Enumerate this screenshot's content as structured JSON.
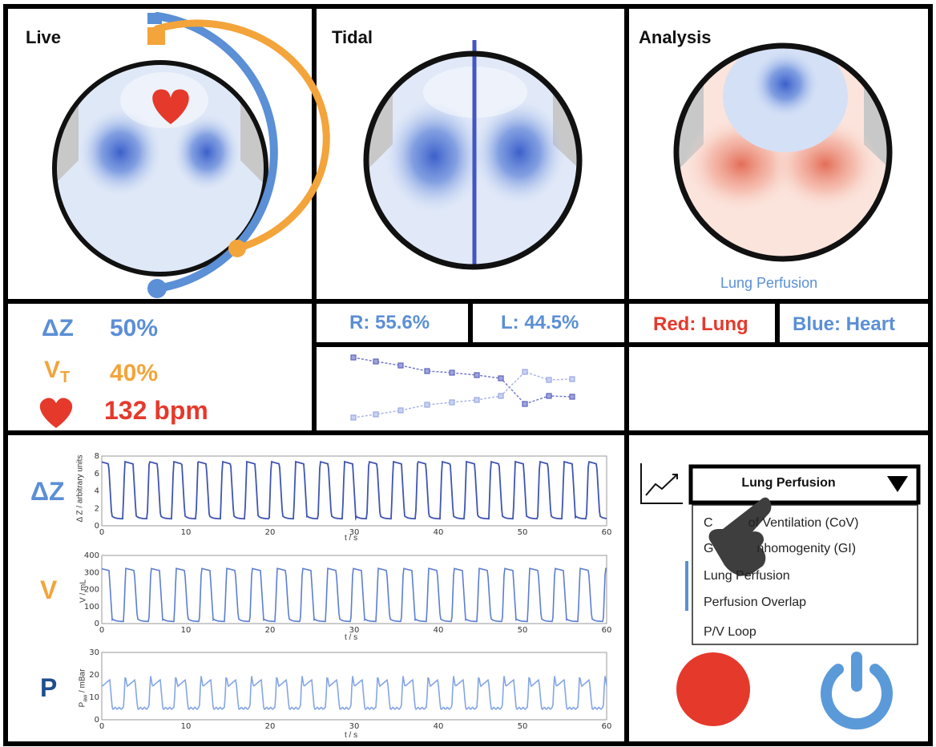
{
  "panels": {
    "live_title": "Live",
    "tidal_title": "Tidal",
    "analysis_title": "Analysis",
    "analysis_caption": "Lung Perfusion"
  },
  "metrics": {
    "dz_symbol": "ΔZ",
    "dz_value": "50%",
    "vt_symbol": "V",
    "vt_sub": "T",
    "vt_value": "40%",
    "heart_rate": "132 bpm"
  },
  "tidal": {
    "right": "R: 55.6%",
    "left": "L: 44.5%"
  },
  "legend": {
    "red": "Red: Lung",
    "blue": "Blue: Heart"
  },
  "waveforms": {
    "dz_label": "ΔZ",
    "v_label": "V",
    "p_label": "P",
    "dz_ylabel": "Δ Z / arbitrary units",
    "v_ylabel": "V / mL",
    "p_ylabel_main": "P",
    "p_ylabel_sub": "aw",
    "p_ylabel_rest": " / mBar",
    "xlabel": "t / s",
    "x_ticks": [
      "0",
      "10",
      "20",
      "30",
      "40",
      "50",
      "60"
    ],
    "dz_yticks": [
      "0",
      "2",
      "4",
      "6",
      "8"
    ],
    "v_yticks": [
      "0",
      "100",
      "200",
      "300",
      "400"
    ],
    "p_yticks": [
      "0",
      "10",
      "20",
      "30"
    ]
  },
  "dropdown": {
    "selected": "Lung Perfusion",
    "items": [
      "Center of Ventilation (CoV)",
      "Global Inhomogenity (GI)",
      "Lung Perfusion",
      "Perfusion Overlap",
      "P/V Loop"
    ],
    "item0_visible": "C",
    "item0_rest": "of Ventilation (CoV)",
    "item1_visible": "G",
    "item1_rest": "nhomogenity (GI)"
  },
  "colors": {
    "blue": "#5b8fd6",
    "orange": "#f3a43a",
    "red": "#e5392b",
    "dark_blue": "#1f4f8f",
    "line": "#3f55b0",
    "line_light": "#7ea3e0"
  }
}
